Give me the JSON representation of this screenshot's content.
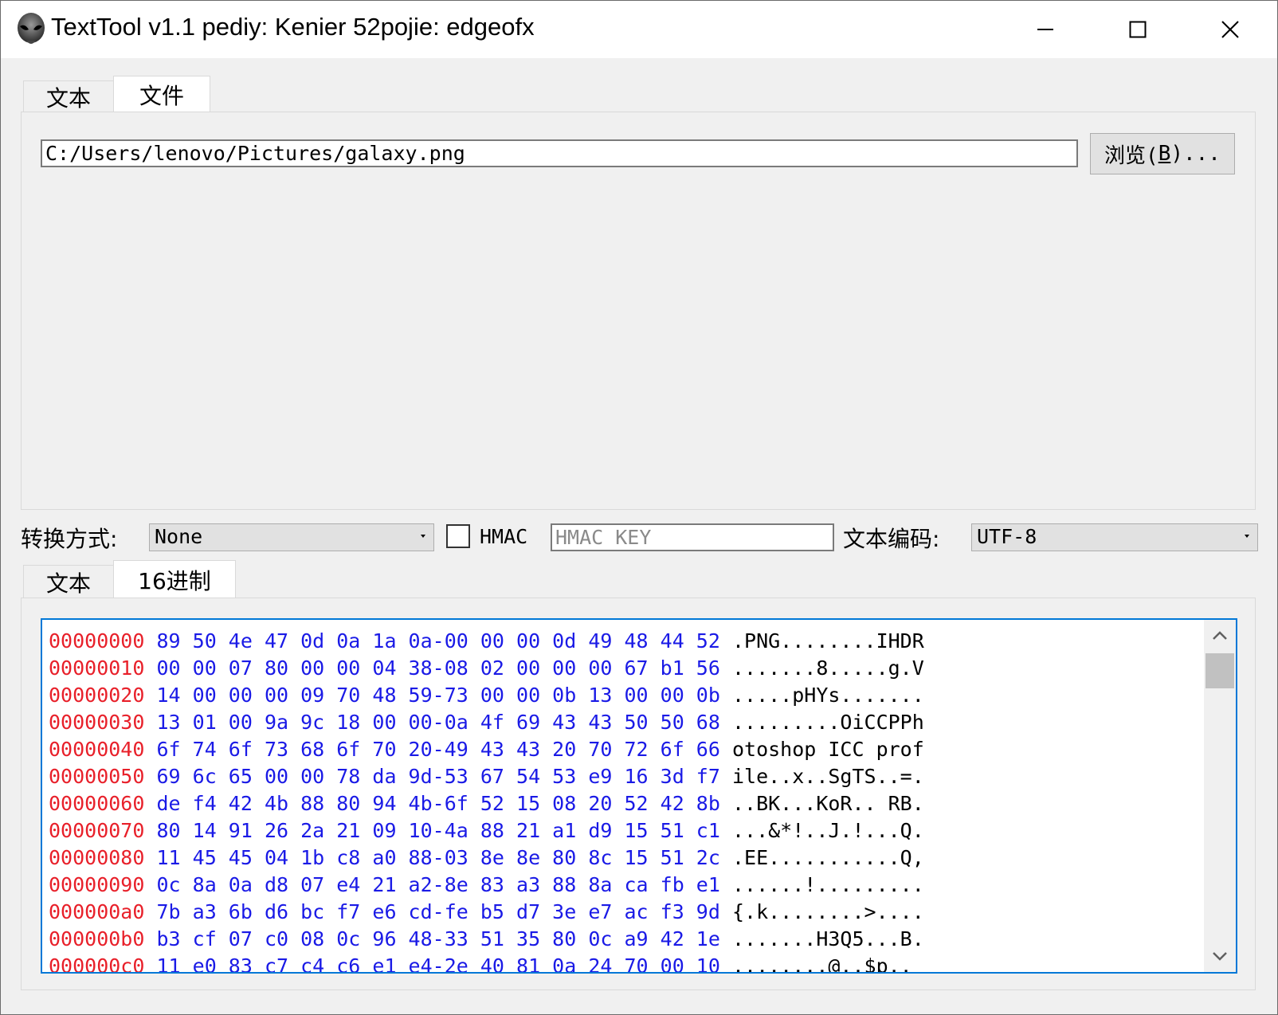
{
  "window": {
    "title": "TextTool v1.1 pediy: Kenier 52pojie: edgeofx"
  },
  "top_tabs": [
    {
      "label": "文本",
      "active": false
    },
    {
      "label": "文件",
      "active": true
    }
  ],
  "file_panel": {
    "path_value": "C:/Users/lenovo/Pictures/galaxy.png",
    "browse_label_prefix": "浏览(",
    "browse_label_mnemonic": "B",
    "browse_label_suffix": ")..."
  },
  "options": {
    "transform_label": "转换方式:",
    "transform_value": "None",
    "hmac_label": "HMAC",
    "hmac_checked": false,
    "hmac_key_placeholder": "HMAC KEY",
    "encoding_label": "文本编码:",
    "encoding_value": "UTF-8"
  },
  "bottom_tabs": [
    {
      "label": "文本",
      "active": false
    },
    {
      "label": "16进制",
      "active": true
    }
  ],
  "hex_lines": [
    {
      "offset": "00000000",
      "bytes": "89 50 4e 47 0d 0a 1a 0a-00 00 00 0d 49 48 44 52",
      "ascii": ".PNG........IHDR"
    },
    {
      "offset": "00000010",
      "bytes": "00 00 07 80 00 00 04 38-08 02 00 00 00 67 b1 56",
      "ascii": ".......8.....g.V"
    },
    {
      "offset": "00000020",
      "bytes": "14 00 00 00 09 70 48 59-73 00 00 0b 13 00 00 0b",
      "ascii": ".....pHYs......."
    },
    {
      "offset": "00000030",
      "bytes": "13 01 00 9a 9c 18 00 00-0a 4f 69 43 43 50 50 68",
      "ascii": ".........OiCCPPh"
    },
    {
      "offset": "00000040",
      "bytes": "6f 74 6f 73 68 6f 70 20-49 43 43 20 70 72 6f 66",
      "ascii": "otoshop ICC prof"
    },
    {
      "offset": "00000050",
      "bytes": "69 6c 65 00 00 78 da 9d-53 67 54 53 e9 16 3d f7",
      "ascii": "ile..x..SgTS..=."
    },
    {
      "offset": "00000060",
      "bytes": "de f4 42 4b 88 80 94 4b-6f 52 15 08 20 52 42 8b",
      "ascii": "..BK...KoR.. RB."
    },
    {
      "offset": "00000070",
      "bytes": "80 14 91 26 2a 21 09 10-4a 88 21 a1 d9 15 51 c1",
      "ascii": "...&*!..J.!...Q."
    },
    {
      "offset": "00000080",
      "bytes": "11 45 45 04 1b c8 a0 88-03 8e 8e 80 8c 15 51 2c",
      "ascii": ".EE...........Q,"
    },
    {
      "offset": "00000090",
      "bytes": "0c 8a 0a d8 07 e4 21 a2-8e 83 a3 88 8a ca fb e1",
      "ascii": "......!........."
    },
    {
      "offset": "000000a0",
      "bytes": "7b a3 6b d6 bc f7 e6 cd-fe b5 d7 3e e7 ac f3 9d",
      "ascii": "{.k........>...."
    },
    {
      "offset": "000000b0",
      "bytes": "b3 cf 07 c0 08 0c 96 48-33 51 35 80 0c a9 42 1e",
      "ascii": ".......H3Q5...B."
    },
    {
      "offset": "000000c0",
      "bytes": "11 e0 83 c7 c4 c6 e1 e4-2e 40 81 0a 24 70 00 10",
      "ascii": "........@..$p.."
    }
  ]
}
